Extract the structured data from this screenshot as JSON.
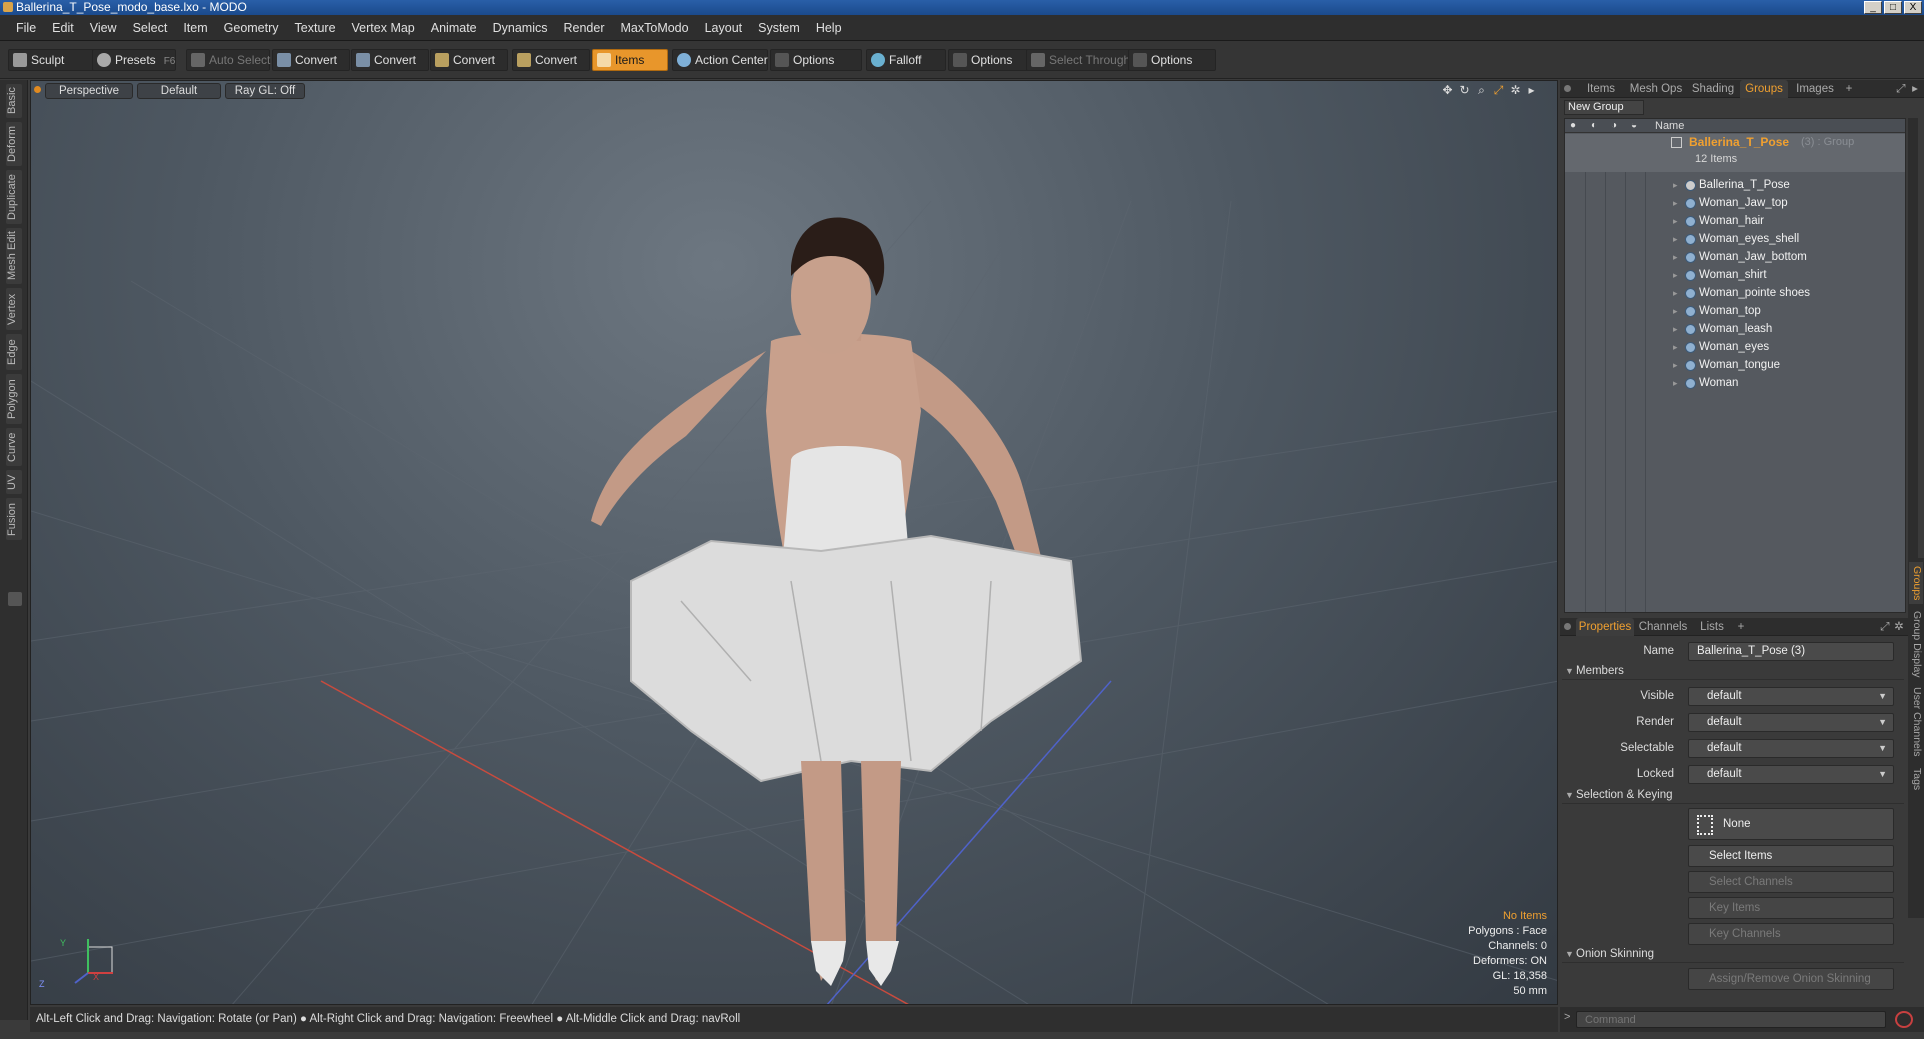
{
  "window": {
    "title": "Ballerina_T_Pose_modo_base.lxo - MODO",
    "controls": [
      "_",
      "□",
      "X"
    ]
  },
  "menu": [
    "File",
    "Edit",
    "View",
    "Select",
    "Item",
    "Geometry",
    "Texture",
    "Vertex Map",
    "Animate",
    "Dynamics",
    "Render",
    "MaxToModo",
    "Layout",
    "System",
    "Help"
  ],
  "toolbar": {
    "sculpt": "Sculpt",
    "presets": "Presets",
    "presets_key": "F6",
    "auto_select": "Auto Select",
    "convert1": "Convert",
    "convert2": "Convert",
    "convert3": "Convert",
    "convert4": "Convert",
    "items": "Items",
    "action_center": "Action Center",
    "options1": "Options",
    "falloff": "Falloff",
    "options2": "Options",
    "select_through": "Select Through",
    "options3": "Options"
  },
  "left_tabs": [
    "Basic",
    "Deform",
    "Duplicate",
    "Mesh Edit",
    "Vertex",
    "Edge",
    "Polygon",
    "Curve",
    "UV",
    "Fusion"
  ],
  "viewport": {
    "view": "Perspective",
    "shading": "Default",
    "raygl": "Ray GL: Off",
    "stats": {
      "selection": "No Items",
      "polygons": "Polygons : Face",
      "channels": "Channels: 0",
      "deformers": "Deformers: ON",
      "gl": "GL: 18,358",
      "distance": "50 mm"
    },
    "axis": {
      "y": "Y",
      "x": "X",
      "z": "Z"
    }
  },
  "status": "Alt-Left Click and Drag: Navigation: Rotate (or Pan) ● Alt-Right Click and Drag: Navigation: Freewheel ● Alt-Middle Click and Drag: navRoll",
  "top_panel": {
    "tabs": [
      "Items",
      "Mesh Ops",
      "Shading",
      "Groups",
      "Images"
    ],
    "active_tab": "Groups",
    "add": "+",
    "new_group": "New Group",
    "column_name": "Name",
    "group": {
      "name": "Ballerina_T_Pose",
      "suffix": "(3) : Group",
      "count": "12 Items"
    },
    "items": [
      "Ballerina_T_Pose",
      "Woman_Jaw_top",
      "Woman_hair",
      "Woman_eyes_shell",
      "Woman_Jaw_bottom",
      "Woman_shirt",
      "Woman_pointe shoes",
      "Woman_top",
      "Woman_leash",
      "Woman_eyes",
      "Woman_tongue",
      "Woman"
    ]
  },
  "properties": {
    "tabs": [
      "Properties",
      "Channels",
      "Lists"
    ],
    "add": "+",
    "name_label": "Name",
    "name_value": "Ballerina_T_Pose (3)",
    "members_section": "Members",
    "visible_label": "Visible",
    "visible_value": "default",
    "render_label": "Render",
    "render_value": "default",
    "selectable_label": "Selectable",
    "selectable_value": "default",
    "locked_label": "Locked",
    "locked_value": "default",
    "selection_section": "Selection & Keying",
    "none_btn": "None",
    "select_items": "Select Items",
    "select_channels": "Select Channels",
    "key_items": "Key Items",
    "key_channels": "Key Channels",
    "onion_section": "Onion Skinning",
    "onion_btn": "Assign/Remove Onion Skinning",
    "side_tabs": [
      "Groups",
      "Group Display",
      "User Channels",
      "Tags"
    ]
  },
  "command": {
    "placeholder": "Command",
    "prompt": ">"
  },
  "colors": {
    "accent": "#f0a030",
    "titlebar": "#1b4a8c",
    "viewport": "#4e5862"
  }
}
